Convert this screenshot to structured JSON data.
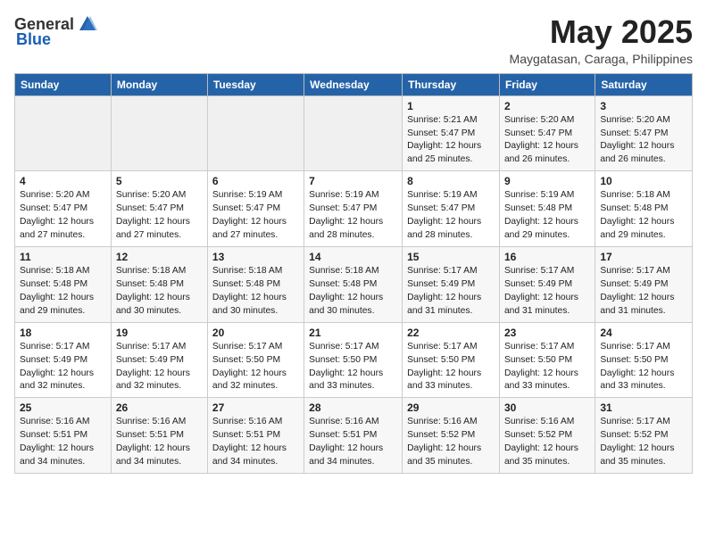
{
  "logo": {
    "general": "General",
    "blue": "Blue"
  },
  "title": "May 2025",
  "location": "Maygatasan, Caraga, Philippines",
  "headers": [
    "Sunday",
    "Monday",
    "Tuesday",
    "Wednesday",
    "Thursday",
    "Friday",
    "Saturday"
  ],
  "weeks": [
    [
      {
        "day": "",
        "info": ""
      },
      {
        "day": "",
        "info": ""
      },
      {
        "day": "",
        "info": ""
      },
      {
        "day": "",
        "info": ""
      },
      {
        "day": "1",
        "info": "Sunrise: 5:21 AM\nSunset: 5:47 PM\nDaylight: 12 hours\nand 25 minutes."
      },
      {
        "day": "2",
        "info": "Sunrise: 5:20 AM\nSunset: 5:47 PM\nDaylight: 12 hours\nand 26 minutes."
      },
      {
        "day": "3",
        "info": "Sunrise: 5:20 AM\nSunset: 5:47 PM\nDaylight: 12 hours\nand 26 minutes."
      }
    ],
    [
      {
        "day": "4",
        "info": "Sunrise: 5:20 AM\nSunset: 5:47 PM\nDaylight: 12 hours\nand 27 minutes."
      },
      {
        "day": "5",
        "info": "Sunrise: 5:20 AM\nSunset: 5:47 PM\nDaylight: 12 hours\nand 27 minutes."
      },
      {
        "day": "6",
        "info": "Sunrise: 5:19 AM\nSunset: 5:47 PM\nDaylight: 12 hours\nand 27 minutes."
      },
      {
        "day": "7",
        "info": "Sunrise: 5:19 AM\nSunset: 5:47 PM\nDaylight: 12 hours\nand 28 minutes."
      },
      {
        "day": "8",
        "info": "Sunrise: 5:19 AM\nSunset: 5:47 PM\nDaylight: 12 hours\nand 28 minutes."
      },
      {
        "day": "9",
        "info": "Sunrise: 5:19 AM\nSunset: 5:48 PM\nDaylight: 12 hours\nand 29 minutes."
      },
      {
        "day": "10",
        "info": "Sunrise: 5:18 AM\nSunset: 5:48 PM\nDaylight: 12 hours\nand 29 minutes."
      }
    ],
    [
      {
        "day": "11",
        "info": "Sunrise: 5:18 AM\nSunset: 5:48 PM\nDaylight: 12 hours\nand 29 minutes."
      },
      {
        "day": "12",
        "info": "Sunrise: 5:18 AM\nSunset: 5:48 PM\nDaylight: 12 hours\nand 30 minutes."
      },
      {
        "day": "13",
        "info": "Sunrise: 5:18 AM\nSunset: 5:48 PM\nDaylight: 12 hours\nand 30 minutes."
      },
      {
        "day": "14",
        "info": "Sunrise: 5:18 AM\nSunset: 5:48 PM\nDaylight: 12 hours\nand 30 minutes."
      },
      {
        "day": "15",
        "info": "Sunrise: 5:17 AM\nSunset: 5:49 PM\nDaylight: 12 hours\nand 31 minutes."
      },
      {
        "day": "16",
        "info": "Sunrise: 5:17 AM\nSunset: 5:49 PM\nDaylight: 12 hours\nand 31 minutes."
      },
      {
        "day": "17",
        "info": "Sunrise: 5:17 AM\nSunset: 5:49 PM\nDaylight: 12 hours\nand 31 minutes."
      }
    ],
    [
      {
        "day": "18",
        "info": "Sunrise: 5:17 AM\nSunset: 5:49 PM\nDaylight: 12 hours\nand 32 minutes."
      },
      {
        "day": "19",
        "info": "Sunrise: 5:17 AM\nSunset: 5:49 PM\nDaylight: 12 hours\nand 32 minutes."
      },
      {
        "day": "20",
        "info": "Sunrise: 5:17 AM\nSunset: 5:50 PM\nDaylight: 12 hours\nand 32 minutes."
      },
      {
        "day": "21",
        "info": "Sunrise: 5:17 AM\nSunset: 5:50 PM\nDaylight: 12 hours\nand 33 minutes."
      },
      {
        "day": "22",
        "info": "Sunrise: 5:17 AM\nSunset: 5:50 PM\nDaylight: 12 hours\nand 33 minutes."
      },
      {
        "day": "23",
        "info": "Sunrise: 5:17 AM\nSunset: 5:50 PM\nDaylight: 12 hours\nand 33 minutes."
      },
      {
        "day": "24",
        "info": "Sunrise: 5:17 AM\nSunset: 5:50 PM\nDaylight: 12 hours\nand 33 minutes."
      }
    ],
    [
      {
        "day": "25",
        "info": "Sunrise: 5:16 AM\nSunset: 5:51 PM\nDaylight: 12 hours\nand 34 minutes."
      },
      {
        "day": "26",
        "info": "Sunrise: 5:16 AM\nSunset: 5:51 PM\nDaylight: 12 hours\nand 34 minutes."
      },
      {
        "day": "27",
        "info": "Sunrise: 5:16 AM\nSunset: 5:51 PM\nDaylight: 12 hours\nand 34 minutes."
      },
      {
        "day": "28",
        "info": "Sunrise: 5:16 AM\nSunset: 5:51 PM\nDaylight: 12 hours\nand 34 minutes."
      },
      {
        "day": "29",
        "info": "Sunrise: 5:16 AM\nSunset: 5:52 PM\nDaylight: 12 hours\nand 35 minutes."
      },
      {
        "day": "30",
        "info": "Sunrise: 5:16 AM\nSunset: 5:52 PM\nDaylight: 12 hours\nand 35 minutes."
      },
      {
        "day": "31",
        "info": "Sunrise: 5:17 AM\nSunset: 5:52 PM\nDaylight: 12 hours\nand 35 minutes."
      }
    ]
  ]
}
